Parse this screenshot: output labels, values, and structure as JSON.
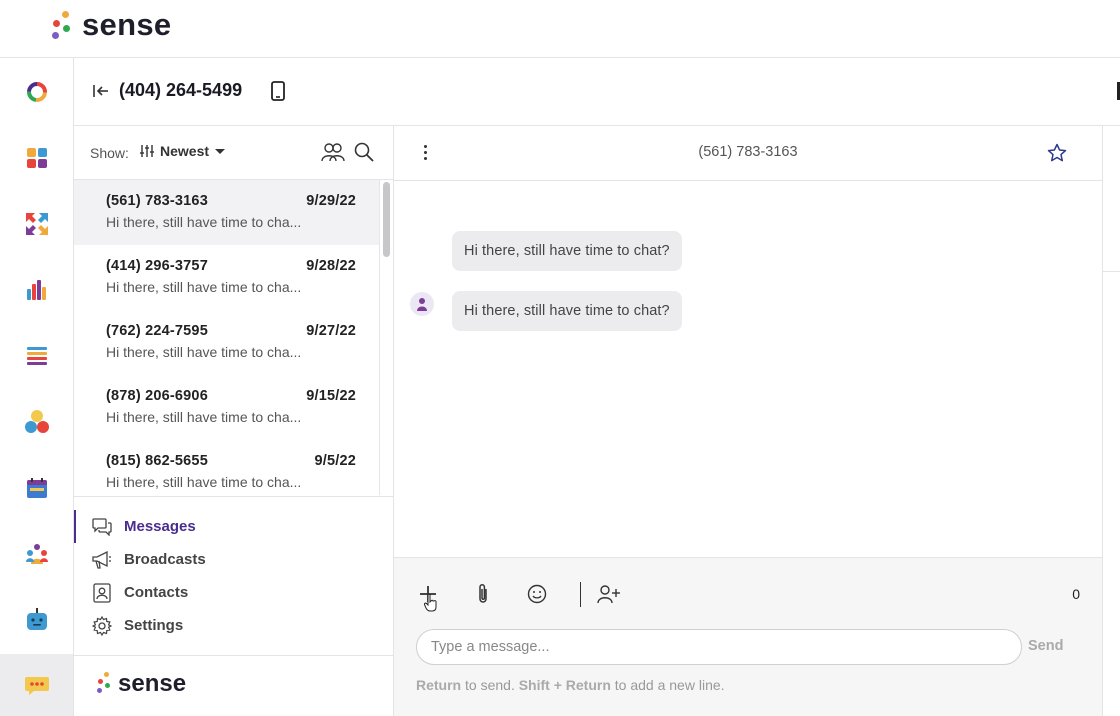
{
  "brand": {
    "name": "sense",
    "dot_colors": [
      "#f2a93b",
      "#e7453c",
      "#2fa84f",
      "#4a2d8f"
    ]
  },
  "rail": {
    "items": [
      {
        "icon": "donut-logo-icon"
      },
      {
        "icon": "dashboard-tiles-icon"
      },
      {
        "icon": "arrows-sync-icon"
      },
      {
        "icon": "bar-chart-icon"
      },
      {
        "icon": "list-icon"
      },
      {
        "icon": "circles-network-icon"
      },
      {
        "icon": "calendar-icon"
      },
      {
        "icon": "people-group-icon"
      },
      {
        "icon": "bot-icon"
      },
      {
        "icon": "chat-bubble-icon",
        "active": true
      }
    ]
  },
  "header": {
    "phone_number": "(404) 264-5499"
  },
  "filters": {
    "show_label": "Show:",
    "sort_value": "Newest"
  },
  "conversations": [
    {
      "number": "(561) 783-3163",
      "date": "9/29/22",
      "preview": "Hi there, still have time to cha...",
      "selected": true
    },
    {
      "number": "(414) 296-3757",
      "date": "9/28/22",
      "preview": "Hi there, still have time to cha..."
    },
    {
      "number": "(762) 224-7595",
      "date": "9/27/22",
      "preview": "Hi there, still have time to cha..."
    },
    {
      "number": "(878) 206-6906",
      "date": "9/15/22",
      "preview": "Hi there, still have time to cha..."
    },
    {
      "number": "(815) 862-5655",
      "date": "9/5/22",
      "preview": "Hi there, still have time to cha..."
    }
  ],
  "nav": {
    "messages": "Messages",
    "broadcasts": "Broadcasts",
    "contacts": "Contacts",
    "settings": "Settings"
  },
  "chat": {
    "title": "(561) 783-3163",
    "messages": [
      {
        "text": "Hi there, still have time to chat?",
        "has_avatar": false
      },
      {
        "text": "Hi there, still have time to chat?",
        "has_avatar": true
      }
    ]
  },
  "composer": {
    "char_count": "0",
    "placeholder": "Type a message...",
    "send_label": "Send",
    "hint_key1": "Return",
    "hint_text1": " to send. ",
    "hint_key2": "Shift + Return",
    "hint_text2": " to add a new line."
  },
  "colors": {
    "accent": "#4a2d8f",
    "rail_active": "#ececef"
  }
}
